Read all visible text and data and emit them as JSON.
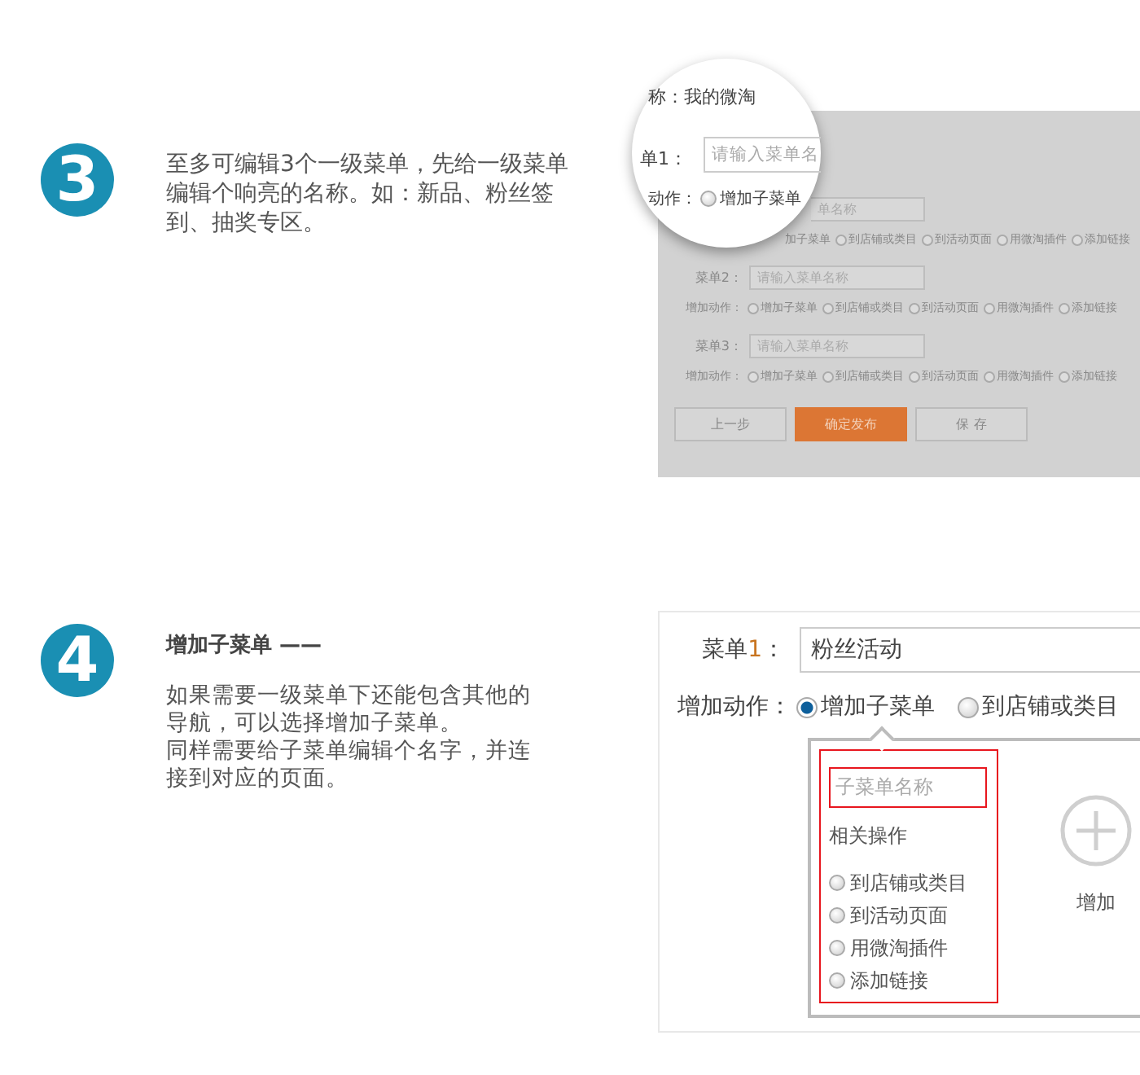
{
  "step_3": {
    "badge": "3",
    "text": "至多可编辑3个一级菜单，先给一级菜单编辑个响亮的名称。如：新品、粉丝签到、抽奖专区。",
    "screenshot": {
      "magnifier": {
        "name_line": "称：我的微淘",
        "menu_label": "单1：",
        "menu_placeholder": "请输入菜单名",
        "action_label": "动作：",
        "option": {
          "label": "增加子菜单",
          "selected": false
        }
      },
      "menus": [
        {
          "placeholder": "单名称",
          "cut_option": "加子菜单",
          "options": [
            {
              "label": "到店铺或类目",
              "selected": false
            },
            {
              "label": "到活动页面",
              "selected": false
            },
            {
              "label": "用微淘插件",
              "selected": false
            },
            {
              "label": "添加链接",
              "selected": false
            }
          ]
        },
        {
          "label": "菜单2：",
          "placeholder": "请输入菜单名称",
          "action_label": "增加动作：",
          "options": [
            {
              "label": "增加子菜单",
              "selected": false
            },
            {
              "label": "到店铺或类目",
              "selected": false
            },
            {
              "label": "到活动页面",
              "selected": false
            },
            {
              "label": "用微淘插件",
              "selected": false
            },
            {
              "label": "添加链接",
              "selected": false
            }
          ]
        },
        {
          "label": "菜单3：",
          "placeholder": "请输入菜单名称",
          "action_label": "增加动作：",
          "options": [
            {
              "label": "增加子菜单",
              "selected": false
            },
            {
              "label": "到店铺或类目",
              "selected": false
            },
            {
              "label": "到活动页面",
              "selected": false
            },
            {
              "label": "用微淘插件",
              "selected": false
            },
            {
              "label": "添加链接",
              "selected": false
            }
          ]
        }
      ],
      "buttons": [
        {
          "label": "上一步",
          "kind": "plain"
        },
        {
          "label": "确定发布",
          "kind": "primary"
        },
        {
          "label": "保 存",
          "kind": "plain"
        }
      ]
    }
  },
  "step_4": {
    "badge": "4",
    "title": "增加子菜单 ——",
    "paragraphs": [
      "如果需要一级菜单下还能包含其他的导航，可以选择增加子菜单。",
      "同样需要给子菜单编辑个名字，并连接到对应的页面。"
    ],
    "screenshot": {
      "menu_label": {
        "prefix": "菜单",
        "number": "1",
        "suffix": "："
      },
      "menu_value": "粉丝活动",
      "action_label": "增加动作：",
      "options": [
        {
          "label": "增加子菜单",
          "selected": true
        },
        {
          "label": "到店铺或类目",
          "selected": false
        }
      ],
      "submenu": {
        "placeholder": "子菜单名称",
        "ops_label": "相关操作",
        "options": [
          {
            "label": "到店铺或类目",
            "selected": false
          },
          {
            "label": "到活动页面",
            "selected": false
          },
          {
            "label": "用微淘插件",
            "selected": false
          },
          {
            "label": "添加链接",
            "selected": false
          }
        ],
        "add_label": "增加"
      }
    }
  }
}
